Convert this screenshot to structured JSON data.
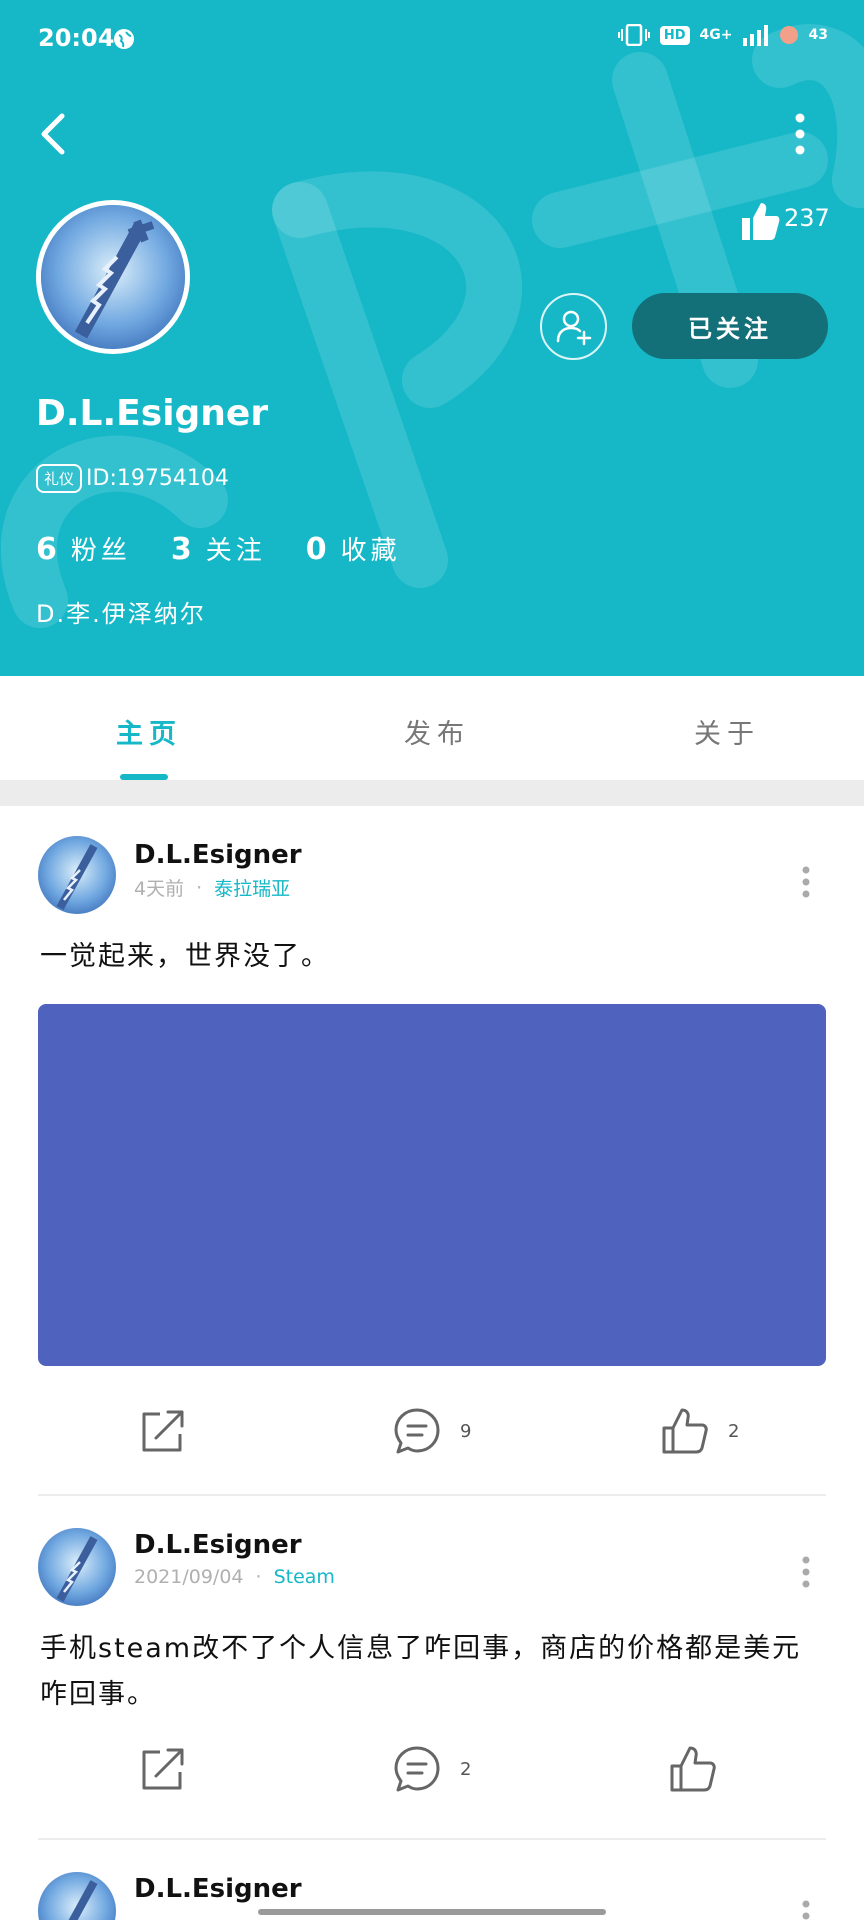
{
  "status_bar": {
    "time": "20:04",
    "hd": "HD",
    "network": "4G+",
    "battery": "43"
  },
  "profile": {
    "likes_count": "237",
    "follow_button": "已关注",
    "name": "D.L.Esigner",
    "badge": "礼仪",
    "id": "ID:19754104",
    "stats": [
      {
        "num": "6",
        "label": "粉丝"
      },
      {
        "num": "3",
        "label": "关注"
      },
      {
        "num": "0",
        "label": "收藏"
      }
    ],
    "bio": "D.李.伊泽纳尔"
  },
  "tabs": [
    {
      "label": "主页"
    },
    {
      "label": "发布"
    },
    {
      "label": "关于"
    }
  ],
  "posts": [
    {
      "author": "D.L.Esigner",
      "time": "4天前",
      "dot": "·",
      "topic": "泰拉瑞亚",
      "text": "一觉起来，世界没了。",
      "comments": "9",
      "likes": "2"
    },
    {
      "author": "D.L.Esigner",
      "time": "2021/09/04",
      "dot": "·",
      "topic": "Steam",
      "text": "手机steam改不了个人信息了咋回事，商店的价格都是美元咋回事。",
      "comments": "2",
      "likes": ""
    },
    {
      "author": "D.L.Esigner"
    }
  ],
  "colors": {
    "accent": "#16b8c8",
    "follow_button_bg": "#136f78",
    "post_image": "#4f62be"
  }
}
